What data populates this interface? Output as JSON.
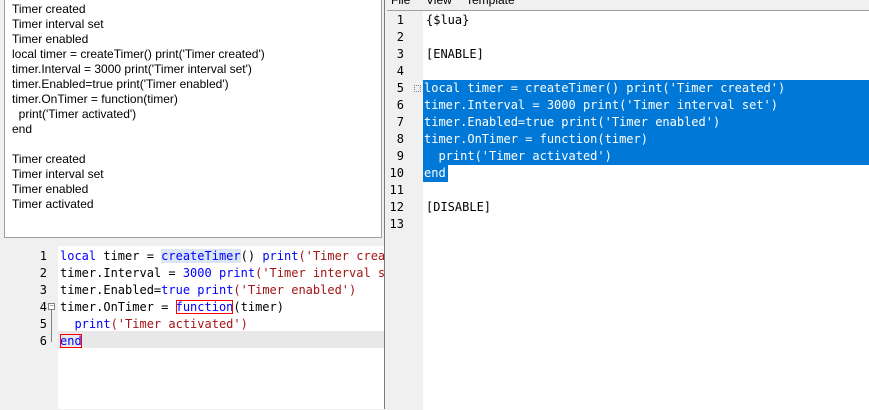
{
  "output": {
    "lines": [
      "Timer created",
      "Timer interval set",
      "Timer enabled",
      "local timer = createTimer() print('Timer created')",
      "timer.Interval = 3000 print('Timer interval set')",
      "timer.Enabled=true print('Timer enabled')",
      "timer.OnTimer = function(timer)",
      "  print('Timer activated')",
      "end",
      "",
      "Timer created",
      "Timer interval set",
      "Timer enabled",
      "Timer activated"
    ]
  },
  "mini_editor": {
    "line_numbers": [
      "1",
      "2",
      "3",
      "4",
      "5",
      "6"
    ],
    "line1": {
      "a": "local",
      "b": " timer = ",
      "c": "createTimer",
      "d": "() ",
      "e": "print",
      "f": "('Timer created')"
    },
    "line2": {
      "a": "timer.Interval = ",
      "b": "3000",
      "c": " ",
      "d": "print",
      "e": "('Timer interval set')"
    },
    "line3": {
      "a": "timer.Enabled=",
      "b": "true",
      "c": " ",
      "d": "print",
      "e": "('Timer enabled')"
    },
    "line4": {
      "a": "timer.OnTimer = ",
      "b": "function",
      "c": "(timer)"
    },
    "line5": {
      "a": "  ",
      "b": "print",
      "c": "('Timer activated')"
    },
    "line6": {
      "a": "end"
    }
  },
  "menu": {
    "file": "File",
    "view": "View",
    "template": "Template"
  },
  "editor": {
    "line_numbers": [
      "1",
      "2",
      "3",
      "4",
      "5",
      "6",
      "7",
      "8",
      "9",
      "10",
      "11",
      "12",
      "13"
    ],
    "lines": [
      "{$lua}",
      "",
      "[ENABLE]",
      "",
      "local timer = createTimer() print('Timer created')",
      "timer.Interval = 3000 print('Timer interval set')",
      "timer.Enabled=true print('Timer enabled')",
      "timer.OnTimer = function(timer)",
      "  print('Timer activated')",
      "end",
      "",
      "[DISABLE]",
      ""
    ]
  },
  "colors": {
    "selection": "#0078d7",
    "keyword": "#0000ff",
    "string": "#a31515"
  }
}
